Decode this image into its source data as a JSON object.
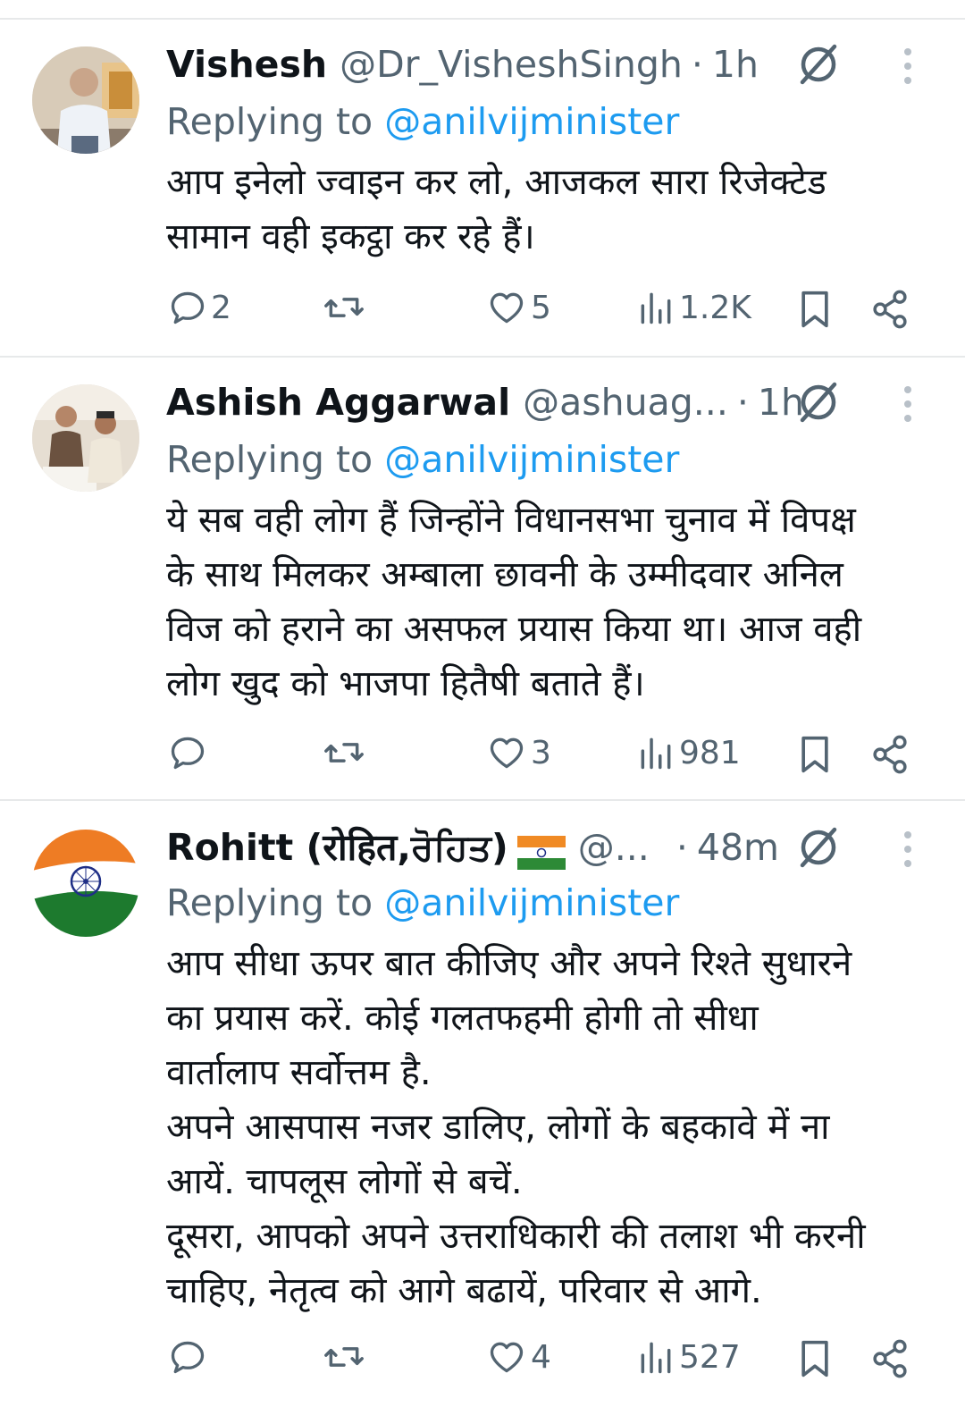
{
  "tweets": [
    {
      "name": "Vishesh",
      "handle": "@Dr_VisheshSingh",
      "separator": "·",
      "time": "1h",
      "replying_prefix": "Replying to",
      "replying_handle": "@anilvijminister",
      "text": "आप इनेलो ज्वाइन कर लो, आजकल सारा रिजेक्टेड\nसामान वही इकट्ठा कर रहे हैं।",
      "replies": "2",
      "retweets": "",
      "likes": "5",
      "views": "1.2K"
    },
    {
      "name": "Ashish Aggarwal",
      "handle": "@ashuag...",
      "separator": "·",
      "time": "1h",
      "replying_prefix": "Replying to",
      "replying_handle": "@anilvijminister",
      "text": "ये सब वही लोग हैं जिन्होंने विधानसभा चुनाव में विपक्ष\nके साथ मिलकर अम्बाला छावनी के उम्मीदवार अनिल\nविज को हराने का असफल प्रयास किया था। आज वही\nलोग खुद को भाजपा हितैषी बताते हैं।",
      "replies": "",
      "retweets": "",
      "likes": "3",
      "views": "981"
    },
    {
      "name": "Rohitt (रोहित,ਰੋਹਿਤ)",
      "handle": "@...",
      "separator": "·",
      "time": "48m",
      "replying_prefix": "Replying to",
      "replying_handle": "@anilvijminister",
      "text": "आप सीधा ऊपर बात कीजिए और अपने रिश्ते सुधारने\nका प्रयास करें. कोई गलतफहमी होगी तो सीधा\nवार्तालाप सर्वोत्तम है.\nअपने आसपास नजर डालिए, लोगों के बहकावे में ना\nआयें. चापलूस लोगों से बचें.\nदूसरा, आपको अपने उत्तराधिकारी की तलाश भी करनी\nचाहिए, नेतृत्व को आगे बढायें, परिवार से आगे.",
      "replies": "",
      "retweets": "",
      "likes": "4",
      "views": "527"
    }
  ],
  "icons": {
    "reply": "reply-icon",
    "retweet": "retweet-icon",
    "like": "heart-icon",
    "views": "views-icon",
    "bookmark": "bookmark-icon",
    "share": "share-icon",
    "grok": "grok-icon",
    "more": "more-icon"
  },
  "colors": {
    "text": "#0f1419",
    "secondary": "#536471",
    "link": "#1d9bf0",
    "divider": "#e7e9ea"
  }
}
